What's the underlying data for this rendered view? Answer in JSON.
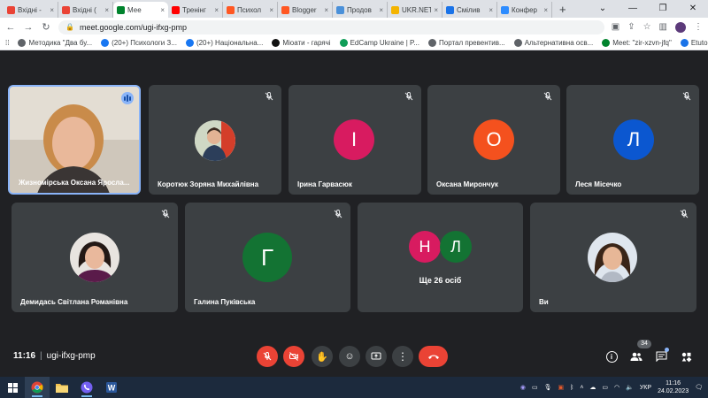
{
  "browser": {
    "tabs": [
      {
        "label": "Вхідні -",
        "icon": "gmail-icon",
        "color": "#ea4335"
      },
      {
        "label": "Вхідні (",
        "icon": "gmail-icon",
        "color": "#ea4335"
      },
      {
        "label": "Мее",
        "icon": "meet-icon",
        "color": "#00832d",
        "active": true
      },
      {
        "label": "Тренінг",
        "icon": "youtube-icon",
        "color": "#ff0000"
      },
      {
        "label": "Психол",
        "icon": "blogger-icon",
        "color": "#ff5722"
      },
      {
        "label": "Blogger",
        "icon": "blogger-icon",
        "color": "#ff5722"
      },
      {
        "label": "Продов",
        "icon": "site-icon",
        "color": "#4a90d9"
      },
      {
        "label": "UKR.NET",
        "icon": "ukrnet-icon",
        "color": "#f4b400"
      },
      {
        "label": "Смілив",
        "icon": "t-icon",
        "color": "#1a73e8"
      },
      {
        "label": "Конфер",
        "icon": "zoom-icon",
        "color": "#2d8cff"
      }
    ],
    "new_tab": "+",
    "url": "meet.google.com/ugi-ifxg-pmp",
    "bookmarks": [
      {
        "label": "Методика \"Два бу...",
        "color": "#5f6368"
      },
      {
        "label": "(20+) Психологи З...",
        "color": "#1877f2"
      },
      {
        "label": "(20+) Національна...",
        "color": "#1877f2"
      },
      {
        "label": "Міоати - гарячі",
        "color": "#111111"
      },
      {
        "label": "EdCamp Ukraine | P...",
        "color": "#0f9d58"
      },
      {
        "label": "Портал превентив...",
        "color": "#5f6368"
      },
      {
        "label": "Альтернативна осв...",
        "color": "#5f6368"
      },
      {
        "label": "Meet: \"zir-xzvn-jfq\"",
        "color": "#00832d"
      },
      {
        "label": "Etutorium",
        "color": "#1a73e8"
      }
    ]
  },
  "meet": {
    "participants": [
      {
        "name": "Жизномірська Оксана Яросла...",
        "type": "video",
        "speaking": true
      },
      {
        "name": "Коротюк Зоряна Михайлівна",
        "type": "photo"
      },
      {
        "name": "Ірина Гарвасюк",
        "type": "letter",
        "letter": "І",
        "color": "#d81b60"
      },
      {
        "name": "Оксана Мирончук",
        "type": "letter",
        "letter": "О",
        "color": "#f4511e"
      },
      {
        "name": "Леся Місечко",
        "type": "letter",
        "letter": "Л",
        "color": "#0b57d0"
      },
      {
        "name": "Демидась Світлана Романівна",
        "type": "photo"
      },
      {
        "name": "Галина Пуківська",
        "type": "letter",
        "letter": "Г",
        "color": "#137333"
      },
      {
        "name": "Ще 26 осіб",
        "type": "group",
        "letters": [
          "Н",
          "Л"
        ],
        "colors": [
          "#d81b60",
          "#137333"
        ]
      },
      {
        "name": "Ви",
        "type": "photo"
      }
    ],
    "time": "11:16",
    "meeting_code": "ugi-ifxg-pmp",
    "participant_count": "34"
  },
  "taskbar": {
    "language": "УКР",
    "time": "11:16",
    "date": "24.02.2023"
  }
}
